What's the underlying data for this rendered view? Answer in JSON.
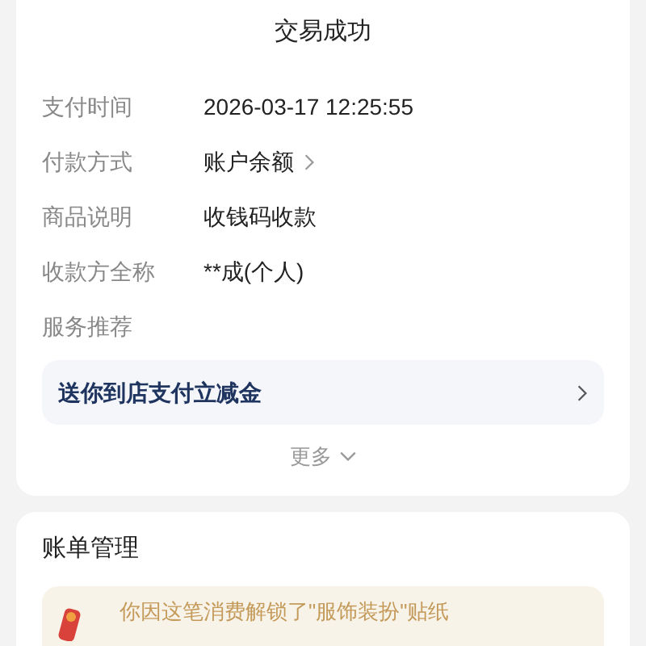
{
  "status": "交易成功",
  "details": [
    {
      "label": "支付时间",
      "value": "2026-03-17 12:25:55",
      "link": false
    },
    {
      "label": "付款方式",
      "value": "账户余额",
      "link": true
    },
    {
      "label": "商品说明",
      "value": "收钱码收款",
      "link": false
    },
    {
      "label": "收款方全称",
      "value": "**成(个人)",
      "link": false
    }
  ],
  "service_heading": "服务推荐",
  "promo": "送你到店支付立减金",
  "more": "更多",
  "bill_section": {
    "title": "账单管理",
    "banner": "你因这笔消费解锁了\"服饰装扮\"贴纸"
  }
}
